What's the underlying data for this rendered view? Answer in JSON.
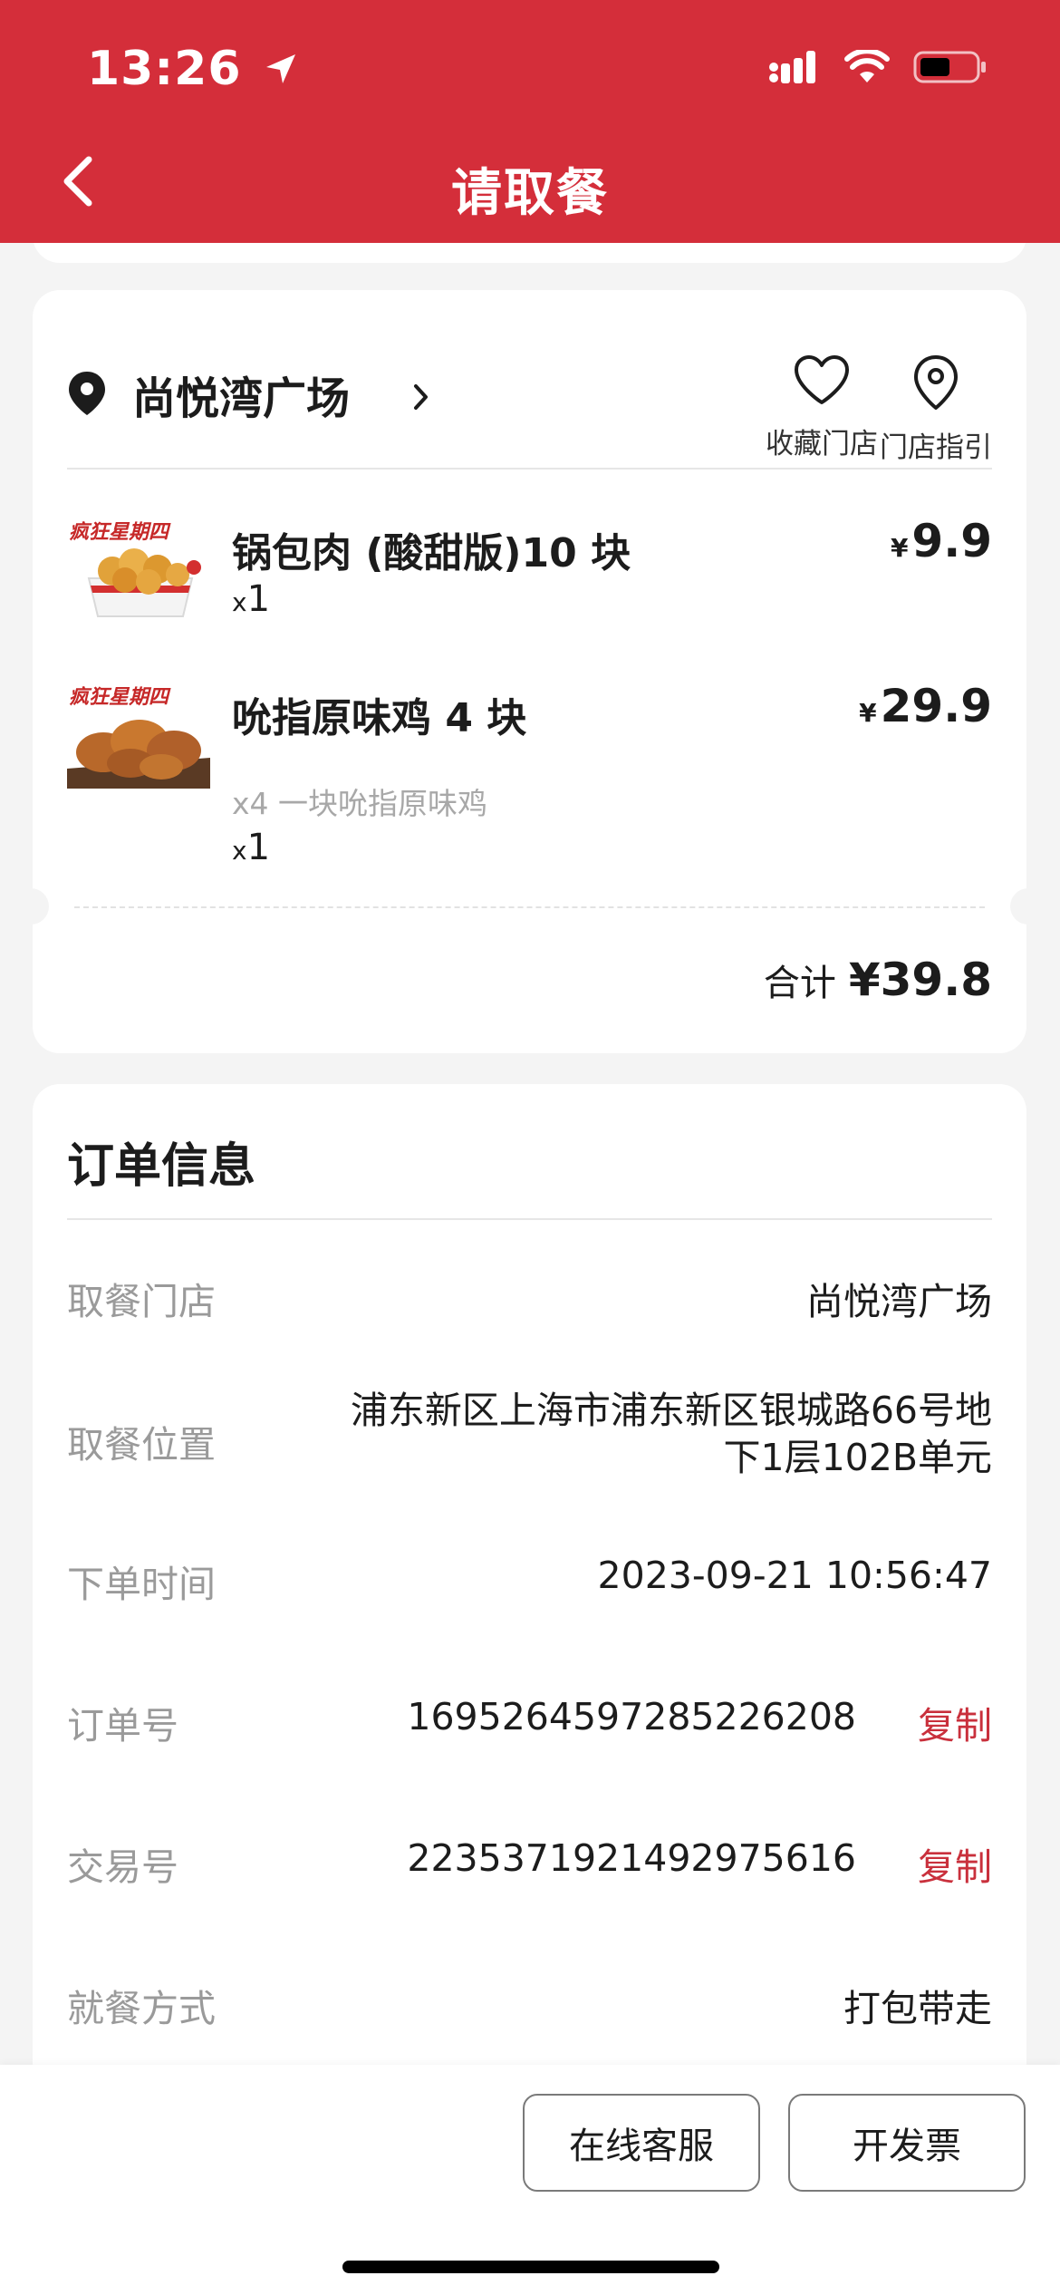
{
  "status_bar": {
    "time": "13:26"
  },
  "header": {
    "title": "请取餐"
  },
  "store": {
    "name": "尚悦湾广场",
    "actions": [
      {
        "label": "收藏门店",
        "icon": "heart-icon"
      },
      {
        "label": "门店指引",
        "icon": "location-pin-icon"
      }
    ]
  },
  "order_items": [
    {
      "name": "锅包肉 (酸甜版)10 块",
      "desc": "",
      "qty_prefix": "x",
      "qty": "1",
      "currency": "¥",
      "price": "9.9"
    },
    {
      "name": "吮指原味鸡 4 块",
      "desc": "x4 一块吮指原味鸡",
      "qty_prefix": "x",
      "qty": "1",
      "currency": "¥",
      "price": "29.9"
    }
  ],
  "total": {
    "label": "合计",
    "amount": "¥39.8"
  },
  "order_info": {
    "title": "订单信息",
    "rows": [
      {
        "label": "取餐门店",
        "value": "尚悦湾广场"
      },
      {
        "label": "取餐位置",
        "value": "浦东新区上海市浦东新区银城路66号地下1层102B单元"
      },
      {
        "label": "下单时间",
        "value": "2023-09-21 10:56:47"
      },
      {
        "label": "订单号",
        "value": "1695264597285226208",
        "action": "复制"
      },
      {
        "label": "交易号",
        "value": "2235371921492975616",
        "action": "复制"
      },
      {
        "label": "就餐方式",
        "value": "打包带走"
      }
    ]
  },
  "bottom_actions": {
    "service": "在线客服",
    "invoice": "开发票"
  },
  "colors": {
    "brand_red": "#d42e3a",
    "copy_red": "#c9303c"
  }
}
